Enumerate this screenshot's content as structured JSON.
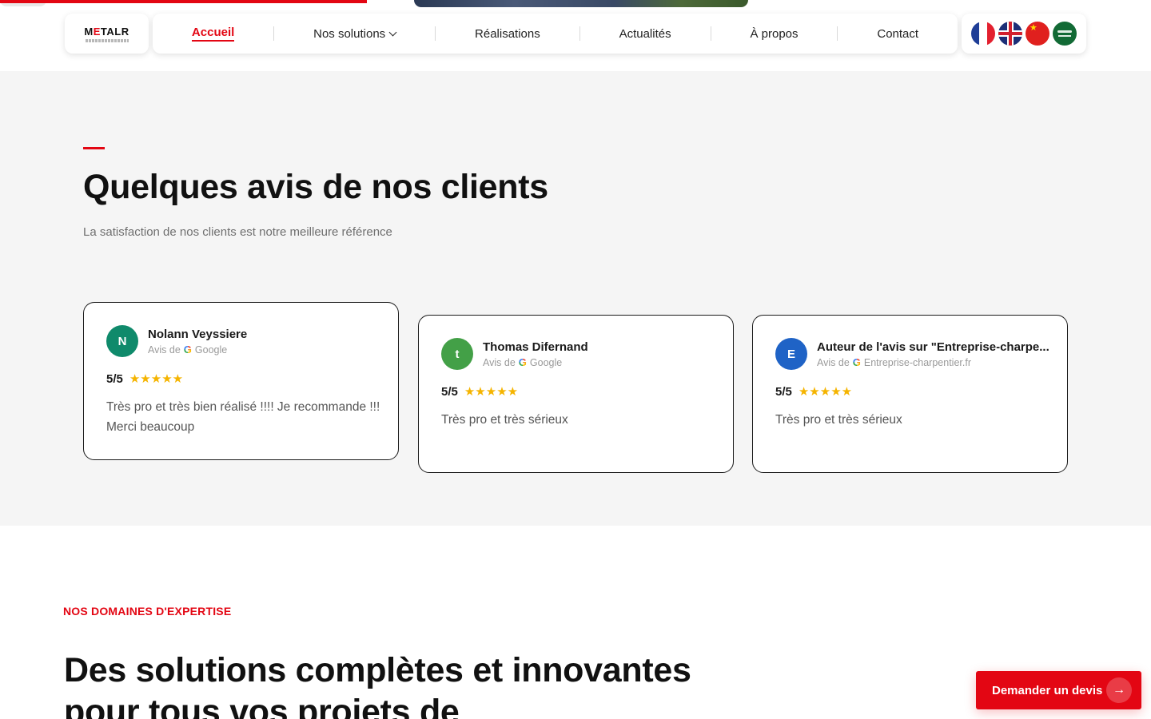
{
  "brand": {
    "logo_text_a": "M",
    "logo_text_accent": "E",
    "logo_text_b": "TALR",
    "accent_color": "#e30613"
  },
  "nav": {
    "items": [
      {
        "label": "Accueil",
        "active": true
      },
      {
        "label": "Nos solutions",
        "has_dropdown": true
      },
      {
        "label": "Réalisations"
      },
      {
        "label": "Actualités"
      },
      {
        "label": "À propos"
      },
      {
        "label": "Contact"
      }
    ],
    "languages": [
      "fr-flag-icon",
      "uk-flag-icon",
      "cn-flag-icon",
      "sa-flag-icon"
    ]
  },
  "reviews": {
    "title": "Quelques avis de nos clients",
    "subtitle": "La satisfaction de nos clients est notre meilleure référence",
    "cards": [
      {
        "initial": "N",
        "avatar_color": "#0f8a6b",
        "name": "Nolann Veyssiere",
        "source_prefix": "Avis de",
        "source": "Google",
        "score": "5/5",
        "stars": 5,
        "text": "Très pro et très bien réalisé !!!! Je recommande !!! Merci beaucoup"
      },
      {
        "initial": "t",
        "avatar_color": "#43a047",
        "name": "Thomas Difernand",
        "source_prefix": "Avis de",
        "source": "Google",
        "score": "5/5",
        "stars": 5,
        "text": "Très pro et très sérieux"
      },
      {
        "initial": "E",
        "avatar_color": "#1f63c6",
        "name": "Auteur de l'avis sur \"Entreprise-charpe...",
        "source_prefix": "Avis de",
        "source": "Entreprise-charpentier.fr",
        "score": "5/5",
        "stars": 5,
        "text": "Très pro et très sérieux"
      }
    ]
  },
  "expertise": {
    "tag": "NOS DOMAINES D'EXPERTISE",
    "title": "Des solutions complètes et innovantes pour tous vos projets de"
  },
  "cta": {
    "label": "Demander un devis"
  }
}
